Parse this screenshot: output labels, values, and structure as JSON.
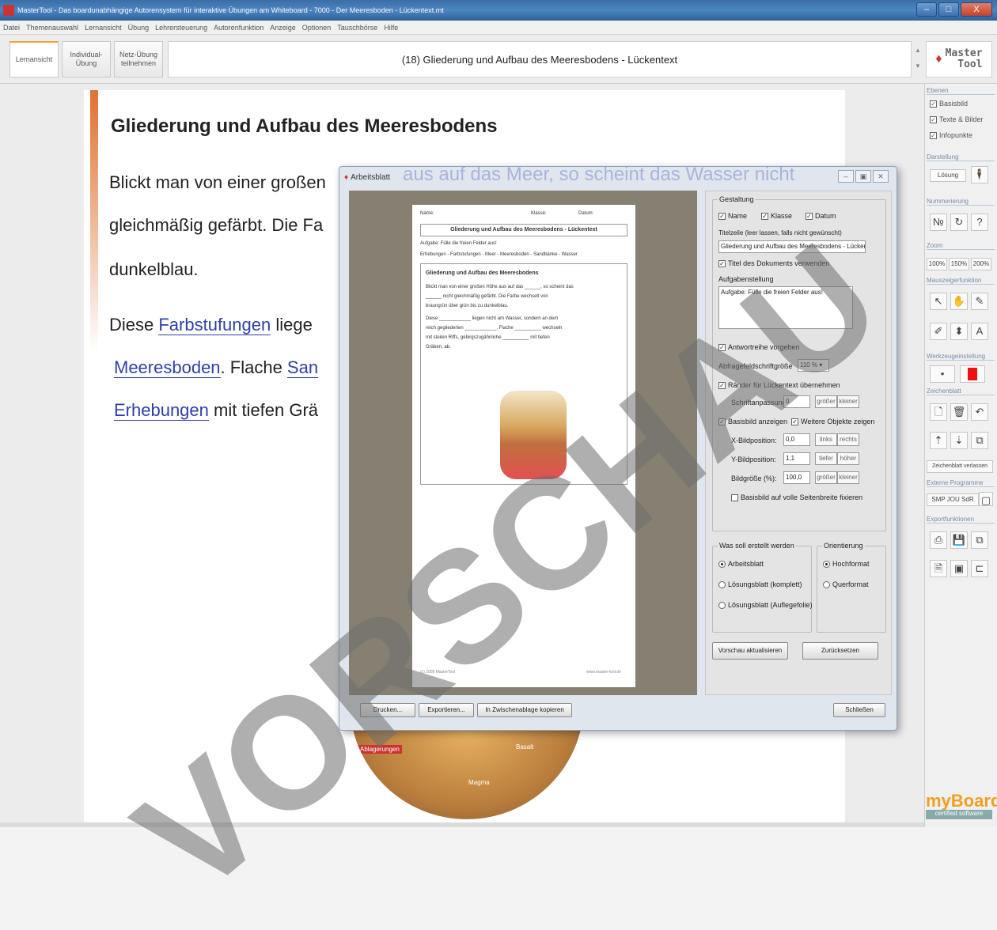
{
  "window": {
    "title": "MasterTool - Das boardunabhängige Autorensystem für interaktive Übungen am Whiteboard - 7000 - Der Meeresboden - Lückentext.mt",
    "min": "‒",
    "max": "□",
    "close": "X"
  },
  "menu": [
    "Datei",
    "Themenauswahl",
    "Lernansicht",
    "Übung",
    "Lehrersteuerung",
    "Autorenfunktion",
    "Anzeige",
    "Optionen",
    "Tauschbörse",
    "Hilfe"
  ],
  "toolbar": {
    "tab_lernansicht": "Lernansicht",
    "tab_individual": "Individual-\nÜbung",
    "tab_netz": "Netz-Übung\nteilnehmen",
    "document_title": "(18) Gliederung und Aufbau des Meeresbodens - Lückentext",
    "logo_line1": "Master",
    "logo_line2": "Tool"
  },
  "page": {
    "heading": "Gliederung und Aufbau des Meeresbodens",
    "line1": "Blickt man von einer großen",
    "line2": "gleichmäßig gefärbt. Die Fa",
    "line3": "dunkelblau.",
    "line4_pre": "Diese ",
    "line4_blank": "Farbstufungen",
    "line4_post": " liege",
    "line5_blank": "Meeresboden",
    "line5_mid": ". Flache ",
    "line5_blank2": "San",
    "line6_blank": "Erhebungen",
    "line6_post": " mit tiefen Grä",
    "ghost_text": "aus auf das Meer, so scheint das Wasser nicht",
    "img_label1": "Ablagerungen",
    "img_label2": "Basalt",
    "img_label3": "Magma"
  },
  "dialog": {
    "title": "Arbeitsblatt",
    "sheet": {
      "name": "Name:",
      "klasse": "Klasse:",
      "datum": "Datum:",
      "heading": "Gliederung und Aufbau des Meeresbodens - Lückentext",
      "task": "Aufgabe: Fülle die freien Felder aus!",
      "words": "Erhebungen - Farbstufungen - Meer - Meeresboden - Sandbänke - Wasser",
      "inner_title": "Gliederung und Aufbau des Meeresbodens",
      "t1": "Blickt man von einer großen Höhe aus auf das ______, so scheint das",
      "t2": "______ nicht gleichmäßig gefärbt. Die Farbe wechselt von",
      "t3": "braungrün über grün bis zu dunkelblau.",
      "t4": "Diese ____________ liegen nicht am Wasser, sondern an dem",
      "t5": "reich gegliederten ____________. Flache __________ wechseln",
      "t6": "mit steilen Riffs, gebirgszugähnliche __________ mit tiefen",
      "t7": "Gräben, ab.",
      "footer_left": "(c) 2009 MasterTool",
      "footer_right": "www.master-tool.de"
    },
    "gestaltung": "Gestaltung",
    "cb_name": "Name",
    "cb_klasse": "Klasse",
    "cb_datum": "Datum",
    "titelzeile_label": "Titelzeile (leer lassen, falls nicht gewünscht)",
    "titelzeile_value": "Gliederung und Aufbau des Meeresbodens - Lückentext",
    "cb_titel": "Titel des Dokuments verwenden",
    "aufgabe_label": "Aufgabenstellung",
    "aufgabe_value": "Aufgabe: Fülle die freien Felder aus!",
    "cb_antwort": "Antwortreihe vorgeben",
    "abfrage_label": "Abfragefeldschriftgröße",
    "abfrage_value": "110 %",
    "cb_raender": "Ränder für Lückentext übernehmen",
    "schrift_label": "Schriftanpassung:",
    "schrift_value": "0",
    "btn_groesser": "größer",
    "btn_kleiner": "kleiner",
    "cb_basisbild": "Basisbild anzeigen",
    "cb_weitere": "Weitere Objekte zeigen",
    "xpos_label": "X-Bildposition:",
    "xpos_value": "0,0",
    "btn_links": "links",
    "btn_rechts": "rechts",
    "ypos_label": "Y-Bildposition:",
    "ypos_value": "1,1",
    "btn_tiefer": "tiefer",
    "btn_hoeher": "höher",
    "groesse_label": "Bildgröße (%):",
    "groesse_value": "100,0",
    "cb_seitenbreite": "Basisbild auf volle Seitenbreite fixieren",
    "was_label": "Was soll erstellt werden",
    "rb_arbeitsblatt": "Arbeitsblatt",
    "rb_loes_kompl": "Lösungsblatt (komplett)",
    "rb_loes_aufleg": "Lösungsblatt (Auflegefolie)",
    "orient_label": "Orientierung",
    "rb_hoch": "Hochformat",
    "rb_quer": "Querformat",
    "btn_vorschau": "Vorschau aktualisieren",
    "btn_zurueck": "Zurücksetzen",
    "btn_drucken": "Drucken...",
    "btn_export": "Exportieren...",
    "btn_clipboard": "In Zwischenablage kopieren",
    "btn_schliessen": "Schließen"
  },
  "sidepanel": {
    "ebenen": "Ebenen",
    "basisbild": "Basisbild",
    "texte": "Texte & Bilder",
    "infopunkte": "Infopunkte",
    "darstellung": "Darstellung",
    "loesung": "Lösung",
    "nummerierung": "Nummerierung",
    "zoom": "Zoom",
    "z100": "100%",
    "z150": "150%",
    "z200": "200%",
    "mauszeiger": "Mauszeigerfunktion",
    "werkzeug": "Werkzeugeinstellung",
    "zeichenblatt": "Zeichenblatt",
    "zeichenblatt_verlassen": "Zeichenblatt verlassen",
    "externe": "Externe Programme",
    "ext_buttons": "SMP JOU SdR",
    "export": "Exportfunktionen",
    "brand": "myBoard",
    "brand_sub": "certified software"
  },
  "watermark": "VORSCHAU"
}
